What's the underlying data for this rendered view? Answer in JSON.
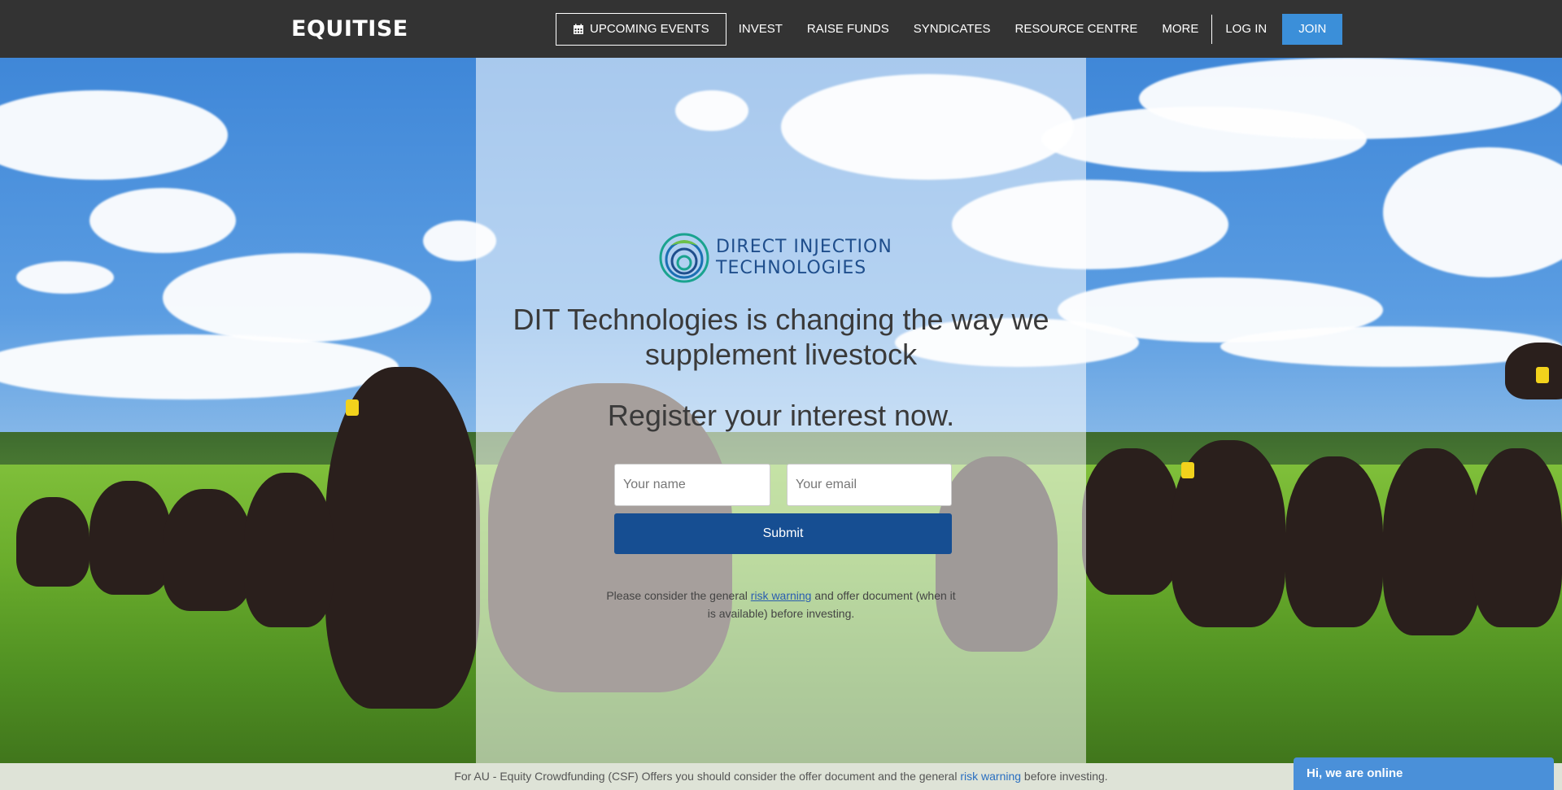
{
  "nav": {
    "brand": "EQUITISE",
    "events_label": "UPCOMING EVENTS",
    "links": [
      "INVEST",
      "RAISE FUNDS",
      "SYNDICATES",
      "RESOURCE CENTRE",
      "MORE"
    ],
    "login": "LOG IN",
    "join": "JOIN",
    "join_color": "#3b8fd9",
    "events_icon": "calendar-icon"
  },
  "hero": {
    "logo_line1": "DIRECT INJECTION",
    "logo_line2": "TECHNOLOGIES",
    "headline": "DIT Technologies is changing the way we supplement livestock",
    "register": "Register your interest now.",
    "name_placeholder": "Your name",
    "email_placeholder": "Your email",
    "submit": "Submit",
    "submit_color": "#164e92",
    "disclaimer_before": "Please consider the general ",
    "disclaimer_link": "risk warning",
    "disclaimer_after": " and offer document (when it is available) before investing."
  },
  "footer": {
    "text_before": "For AU - Equity Crowdfunding (CSF) Offers you should consider the offer document and the general ",
    "link": "risk warning",
    "text_after": " before investing."
  },
  "chat": {
    "label": "Hi, we are online",
    "color": "#4a90d9"
  }
}
